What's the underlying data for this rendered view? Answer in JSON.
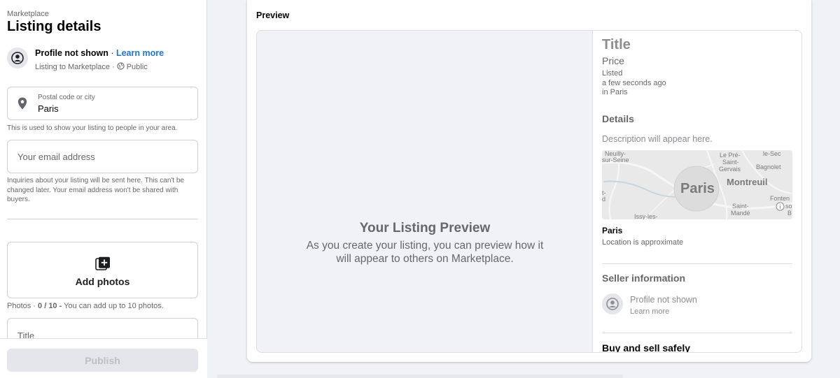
{
  "sidebar": {
    "breadcrumb": "Marketplace",
    "title": "Listing details",
    "profile": {
      "name": "Profile not shown",
      "separator": " · ",
      "learn_more": "Learn more",
      "listing_to": "Listing to Marketplace ·",
      "audience": "Public"
    },
    "location": {
      "label": "Postal code or city",
      "value": "Paris",
      "hint": "This is used to show your listing to people in your area."
    },
    "email": {
      "placeholder": "Your email address",
      "hint": "Inquiries about your listing will be sent here. This can't be changed later. Your email address won't be shared with buyers."
    },
    "photos": {
      "add_label": "Add photos",
      "count_prefix": "Photos · ",
      "count": "0 / 10 -",
      "count_suffix": " You can add up to 10 photos."
    },
    "title_field": {
      "placeholder": "Title"
    },
    "publish_label": "Publish"
  },
  "preview": {
    "header": "Preview",
    "empty_title": "Your Listing Preview",
    "empty_subtitle": "As you create your listing, you can preview how it will appear to others on Marketplace.",
    "title": "Title",
    "price": "Price",
    "listed_line1": "Listed",
    "listed_line2": "a few seconds ago",
    "listed_line3": "in Paris",
    "details_heading": "Details",
    "description": "Description will appear here.",
    "map": {
      "neuilly": "Neuilly-",
      "neuilly2": "sur-Seine",
      "lepre": "Le Pré-",
      "lepre2": "Saint-",
      "lepre3": "Gervais",
      "lesec": "le-Sec",
      "bagnolet": "Bagnolet",
      "paris": "Paris",
      "montreuil": "Montreuil",
      "stmande": "Saint-",
      "stmande2": "Mandé",
      "fonten": "Fonten",
      "issy": "Issy-les-",
      "edge_t": "t-",
      "edge_d": "d",
      "edge_so": "so",
      "edge_b": "B"
    },
    "city": "Paris",
    "location_note": "Location is approximate",
    "seller_heading": "Seller information",
    "seller_name": "Profile not shown",
    "seller_learn": "Learn more",
    "buy_sell": "Buy and sell safely"
  },
  "colors": {
    "accent": "#1b74e4",
    "page_bg": "#f0f2f5",
    "muted_text": "#65676b"
  },
  "icons": [
    "avatar-icon",
    "globe-icon",
    "location-pin-icon",
    "add-photo-icon",
    "info-icon"
  ]
}
